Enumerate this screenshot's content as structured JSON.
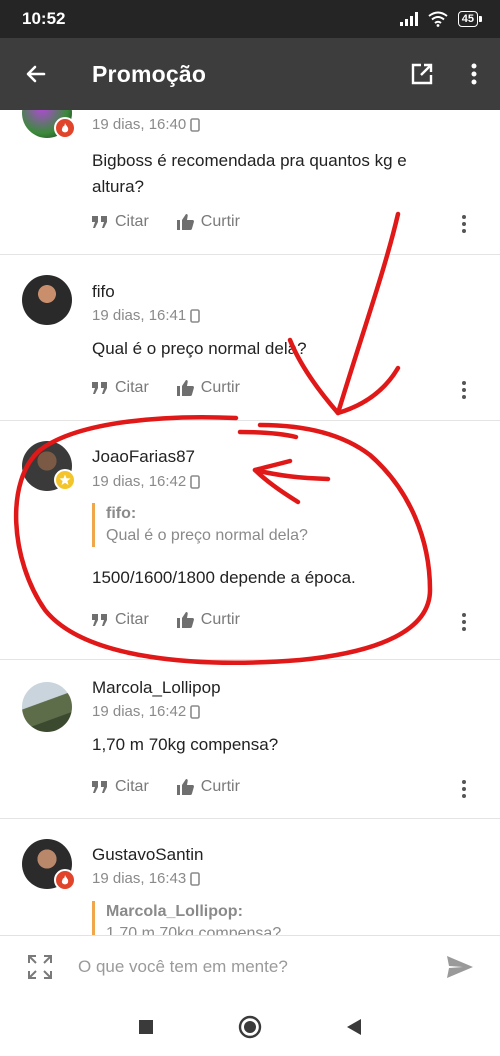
{
  "status_bar": {
    "time": "10:52",
    "battery": "45"
  },
  "app_bar": {
    "title": "Promoção",
    "back_icon": "arrow-left-icon",
    "open_icon": "open-external-icon",
    "menu_icon": "more-vertical-icon"
  },
  "posts": [
    {
      "username": "",
      "meta": "19 dias, 16:40",
      "body": "Bigboss é recomendada pra quantos kg e altura?",
      "cite_label": "Citar",
      "like_label": "Curtir",
      "badge": "fire-badge-icon"
    },
    {
      "username": "fifo",
      "meta": "19 dias, 16:41",
      "body": "Qual é o preço normal dela?",
      "cite_label": "Citar",
      "like_label": "Curtir"
    },
    {
      "username": "JoaoFarias87",
      "meta": "19 dias, 16:42",
      "quote_author": "fifo:",
      "quote_text": "Qual é o preço normal dela?",
      "body": "1500/1600/1800 depende a época.",
      "cite_label": "Citar",
      "like_label": "Curtir",
      "badge": "star-badge-icon"
    },
    {
      "username": "Marcola_Lollipop",
      "meta": "19 dias, 16:42",
      "body": "1,70 m 70kg compensa?",
      "cite_label": "Citar",
      "like_label": "Curtir"
    },
    {
      "username": "GustavoSantin",
      "meta": "19 dias, 16:43",
      "quote_author": "Marcola_Lollipop:",
      "quote_text": "1,70 m 70kg compensa?",
      "badge": "fire-badge-icon"
    }
  ],
  "composer": {
    "placeholder": "O que você tem em mente?",
    "expand_icon": "expand-icon",
    "send_icon": "send-icon"
  },
  "nav_bar": {
    "recent_icon": "square-icon",
    "home_icon": "circle-icon",
    "back_icon": "triangle-back-icon"
  },
  "colors": {
    "app_bar": "#3d3d3e",
    "status_bar": "#252526",
    "quote_border": "#f0a64b",
    "annotation": "#e01818",
    "fire_badge": "#e0442a",
    "star_badge": "#f4c52a"
  }
}
